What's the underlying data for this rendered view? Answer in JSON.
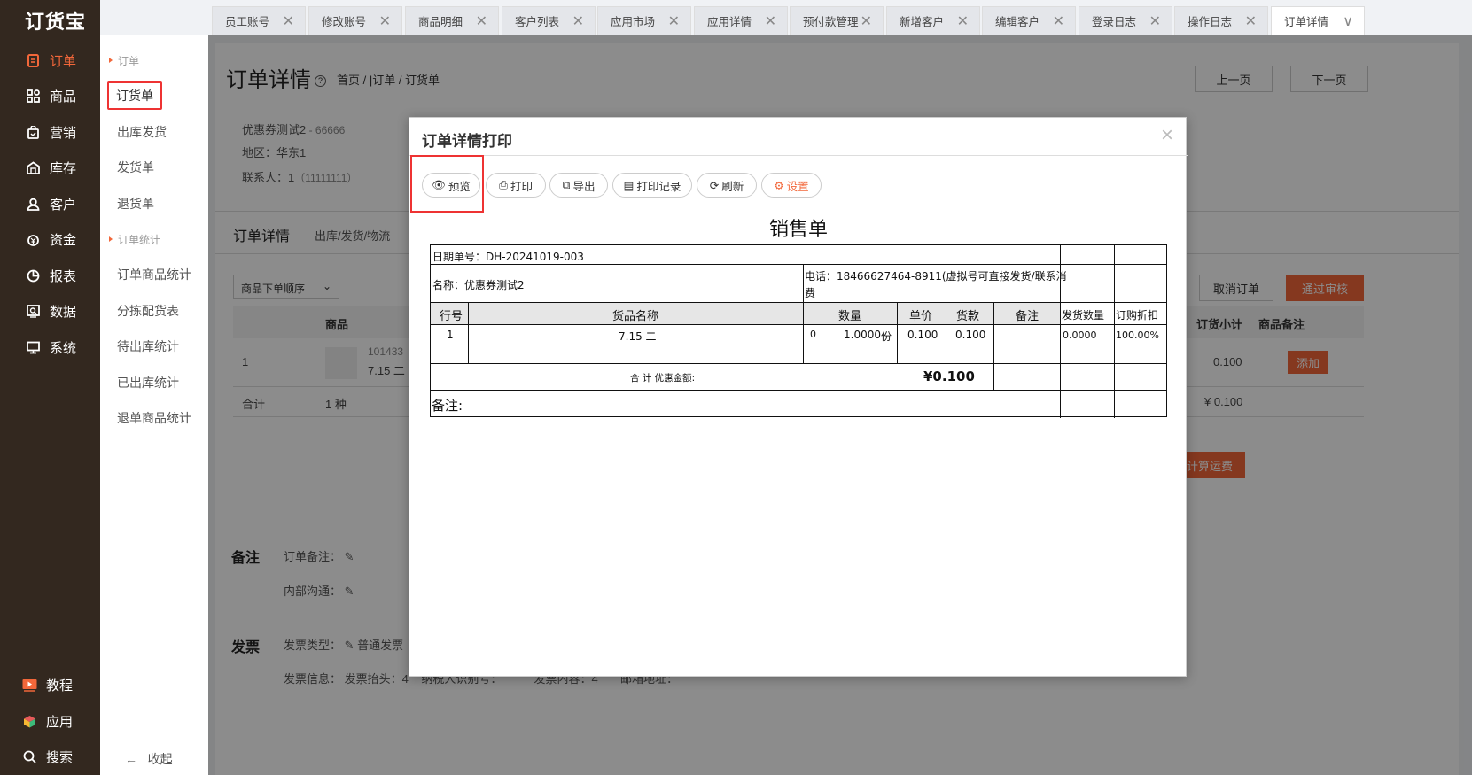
{
  "app": {
    "logo": "订货宝"
  },
  "nav": {
    "items": [
      {
        "label": "订单",
        "icon": "order-icon"
      },
      {
        "label": "商品",
        "icon": "grid-icon"
      },
      {
        "label": "营销",
        "icon": "bag-icon"
      },
      {
        "label": "库存",
        "icon": "warehouse-icon"
      },
      {
        "label": "客户",
        "icon": "user-icon"
      },
      {
        "label": "资金",
        "icon": "money-icon"
      },
      {
        "label": "报表",
        "icon": "pie-chart-icon"
      },
      {
        "label": "数据",
        "icon": "data-icon"
      },
      {
        "label": "系统",
        "icon": "monitor-icon"
      }
    ],
    "bottom": [
      {
        "label": "教程",
        "icon": "play-icon"
      },
      {
        "label": "应用",
        "icon": "cube-icon"
      },
      {
        "label": "搜索",
        "icon": "search-icon"
      }
    ]
  },
  "submenu": {
    "group1": "订单",
    "items1": [
      "订货单",
      "出库发货",
      "发货单",
      "退货单"
    ],
    "group2": "订单统计",
    "items2": [
      "订单商品统计",
      "分拣配货表",
      "待出库统计",
      "已出库统计",
      "退单商品统计"
    ],
    "collapse": "收起"
  },
  "tabs": [
    "员工账号",
    "修改账号",
    "商品明细",
    "客户列表",
    "应用市场",
    "应用详情",
    "预付款管理",
    "新增客户",
    "编辑客户",
    "登录日志",
    "操作日志",
    "订单详情"
  ],
  "page": {
    "title": "订单详情",
    "breadcrumb": "首页 / |订单 / 订货单",
    "prev": "上一页",
    "next": "下一页",
    "customer": "优惠券测试2",
    "customer_code": " - 66666",
    "region": "地区：华东1",
    "contact": "联系人：1",
    "contact_phone": "（11111111）",
    "tab1": "订单详情",
    "tab2": "出库/发货/物流",
    "sort_select": "商品下单顺序",
    "cancel_btn": "取消订单",
    "approve_btn": "通过审核",
    "col_product": "商品",
    "col_subtotal": "订货小计",
    "col_remark": "商品备注",
    "row_no": "1",
    "row_code": "101433",
    "row_name": "7.15 二",
    "row_subtotal": "0.100",
    "add_btn": "添加",
    "total_label": "合计",
    "total_kinds": "1 种",
    "total_amount": "¥ 0.100",
    "freight_btn": "计算运费",
    "remark_section": "备注",
    "order_remark": "订单备注：",
    "internal": "内部沟通：",
    "invoice_section": "发票",
    "invoice_type_label": "发票类型：",
    "invoice_type": "普通发票",
    "invoice_info": "发票信息：",
    "invoice_title": "发票抬头：",
    "invoice_title_val": "4",
    "taxpayer": "纳税人识别号：",
    "content": "发票内容：",
    "content_val": "4",
    "email": "邮箱地址："
  },
  "modal": {
    "title": "订单详情打印",
    "buttons": {
      "preview": "预览",
      "print": "打印",
      "export": "导出",
      "records": "打印记录",
      "refresh": "刷新",
      "settings": "设置"
    },
    "doc_title": "销售单",
    "date_no": "日期单号：DH-20241019-003",
    "name": "名称：优惠券测试2",
    "phone_line1": "电话：18466627464-8911(虚拟号可直接发货/联系消",
    "phone_line2": "费",
    "headers": [
      "行号",
      "货品名称",
      "数量",
      "单价",
      "货款",
      "备注",
      "发货数量",
      "订购折扣"
    ],
    "row": {
      "no": "1",
      "name": "7.15 二",
      "qty_left": "0",
      "qty": "1.0000",
      "unit": "份",
      "price": "0.100",
      "amount": "0.100",
      "ship_qty": "0.0000",
      "discount": "100.00%"
    },
    "total_label": "合 计 优惠金额:",
    "total_value": "¥0.100",
    "remark": "备注:"
  }
}
